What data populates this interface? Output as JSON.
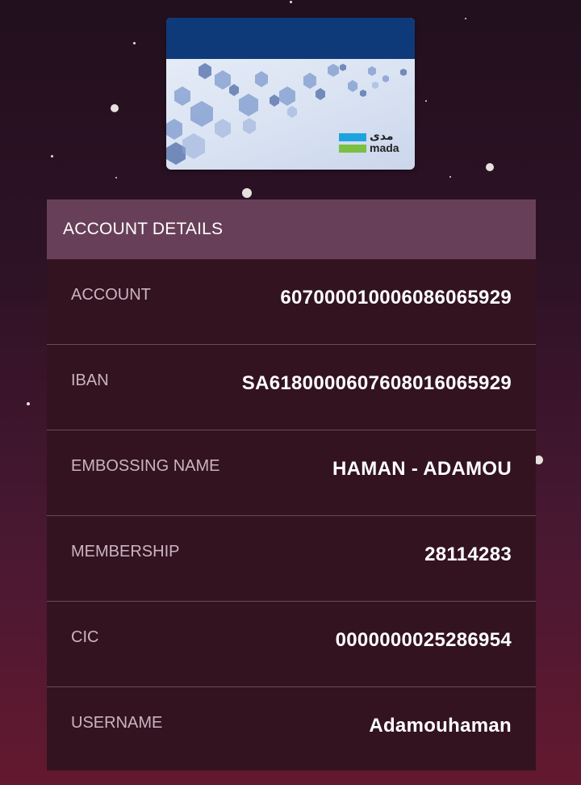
{
  "card": {
    "brand_ar": "مدى",
    "brand_en": "mada",
    "colors": {
      "band": "#0e3a7a",
      "logo_blue": "#1fa3e0",
      "logo_green": "#7bc043"
    }
  },
  "panel": {
    "header": "ACCOUNT DETAILS",
    "rows": [
      {
        "label": "ACCOUNT",
        "value": "607000010006086065929"
      },
      {
        "label": "IBAN",
        "value": "SA6180000607608016065929"
      },
      {
        "label": "EMBOSSING NAME",
        "value": "HAMAN - ADAMOU"
      },
      {
        "label": "MEMBERSHIP",
        "value": "28114283"
      },
      {
        "label": "CIC",
        "value": "0000000025286954"
      },
      {
        "label": "USERNAME",
        "value": "Adamouhaman"
      }
    ]
  }
}
